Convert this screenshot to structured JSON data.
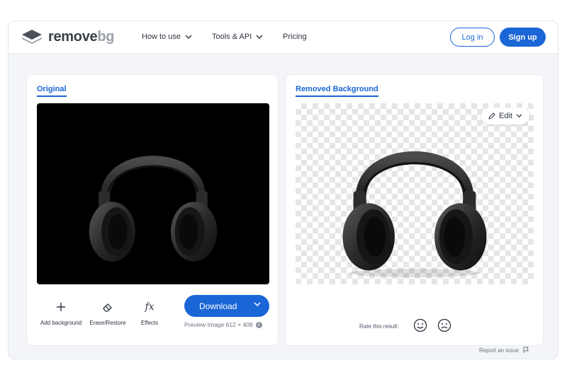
{
  "brand": {
    "name_dark": "remove",
    "name_light": "bg",
    "logo_icon": "stacked-layers-icon"
  },
  "nav": {
    "items": [
      {
        "label": "How to use",
        "has_dropdown": true
      },
      {
        "label": "Tools & API",
        "has_dropdown": true
      },
      {
        "label": "Pricing",
        "has_dropdown": false
      }
    ],
    "login_label": "Log in",
    "signup_label": "Sign up"
  },
  "original_panel": {
    "tab_label": "Original",
    "image_subject": "black over-ear headphones on black background",
    "tools": [
      {
        "label": "Add background",
        "icon": "plus-icon"
      },
      {
        "label": "Erase/Restore",
        "icon": "eraser-icon"
      },
      {
        "label": "Effects",
        "icon": "fx-icon"
      }
    ],
    "download_label": "Download",
    "preview_note": "Preview Image 612 × 408"
  },
  "removed_panel": {
    "tab_label": "Removed Background",
    "image_subject": "black over-ear headphones on transparent checkerboard",
    "edit_label": "Edit",
    "rate_label": "Rate this result:",
    "report_label": "Report an issue"
  },
  "colors": {
    "accent": "#1a66d6",
    "page_bg": "#f3f5f8",
    "card_bg": "#ffffff",
    "image_bg": "#000000"
  }
}
